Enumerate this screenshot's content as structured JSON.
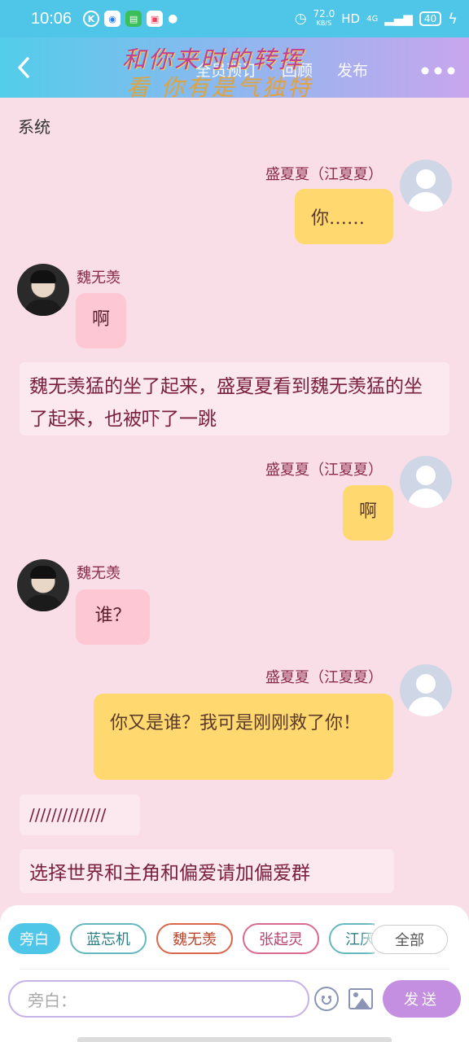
{
  "status_bar": {
    "time": "10:06",
    "network_speed": "72.0",
    "network_unit": "KB/S",
    "hd_label": "HD",
    "signal_label": "4G",
    "battery": "40"
  },
  "header": {
    "back_icon": "chevron-left-icon",
    "title": "和你来时的转挥",
    "subtitle": "看 你有是气独特",
    "tabs": [
      "全员预订",
      "回顾",
      "发布"
    ],
    "more_icon": "more-dots-icon"
  },
  "chat": {
    "system_label": "系统",
    "messages": [
      {
        "sender": "盛夏夏（江夏夏）",
        "text": "你……",
        "side": "right"
      },
      {
        "sender": "魏无羡",
        "text": "啊",
        "side": "left"
      },
      {
        "narration": "魏无羡猛的坐了起来，盛夏夏看到魏无羡猛的坐了起来，也被吓了一跳"
      },
      {
        "sender": "盛夏夏（江夏夏）",
        "text": "啊",
        "side": "right"
      },
      {
        "sender": "魏无羡",
        "text": "谁？",
        "side": "left"
      },
      {
        "sender": "盛夏夏（江夏夏）",
        "text": "你又是谁？我可是刚刚救了你！",
        "side": "right"
      },
      {
        "narration": "//////////////"
      },
      {
        "narration": "选择世界和主角和偏爱请加偏爱群"
      }
    ]
  },
  "composer": {
    "roles": [
      "旁白",
      "蓝忘机",
      "魏无羡",
      "张起灵",
      "江厌"
    ],
    "all_label": "全部",
    "input_placeholder": "旁白：",
    "emoji_icon": "emoji-icon",
    "image_icon": "image-icon",
    "send_label": "发送"
  },
  "colors": {
    "header_start": "#52cdea",
    "header_end": "#c8a6ee",
    "background": "#f9dde7",
    "self_bubble": "#ffd970",
    "other_bubble": "#fdc7d4",
    "send_button": "#c48fe0"
  }
}
